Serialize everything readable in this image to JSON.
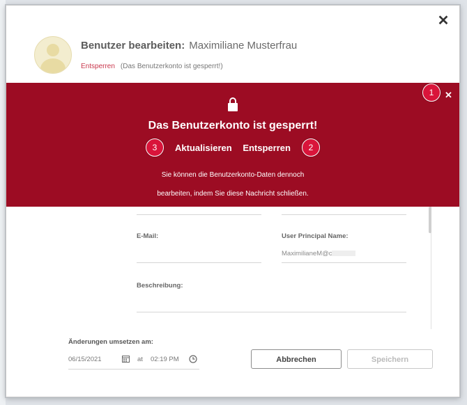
{
  "dialog": {
    "title_label": "Benutzer bearbeiten:",
    "user_name": "Maximiliane Musterfrau",
    "unlock_link": "Entsperren",
    "locked_note": "(Das Benutzerkonto ist gesperrt!)",
    "close_icon": "close-icon"
  },
  "banner": {
    "headline": "Das Benutzerkonto ist gesperrt!",
    "refresh": "Aktualisieren",
    "unlock": "Entsperren",
    "message_line1": "Sie können die Benutzerkonto-Daten dennoch",
    "message_line2": "bearbeiten, indem Sie diese Nachricht schließen.",
    "color": "#9c0c23"
  },
  "badges": {
    "close": "1",
    "unlock": "2",
    "refresh": "3",
    "color": "#d9143a"
  },
  "form": {
    "email_label": "E-Mail:",
    "email_value": "",
    "upn_label": "User Principal Name:",
    "upn_value": "MaximilianeM@c",
    "description_label": "Beschreibung:",
    "description_value": ""
  },
  "footer": {
    "apply_label": "Änderungen umsetzen am:",
    "date": "06/15/2021",
    "at": "at",
    "time": "02:19 PM",
    "cancel": "Abbrechen",
    "save": "Speichern"
  }
}
